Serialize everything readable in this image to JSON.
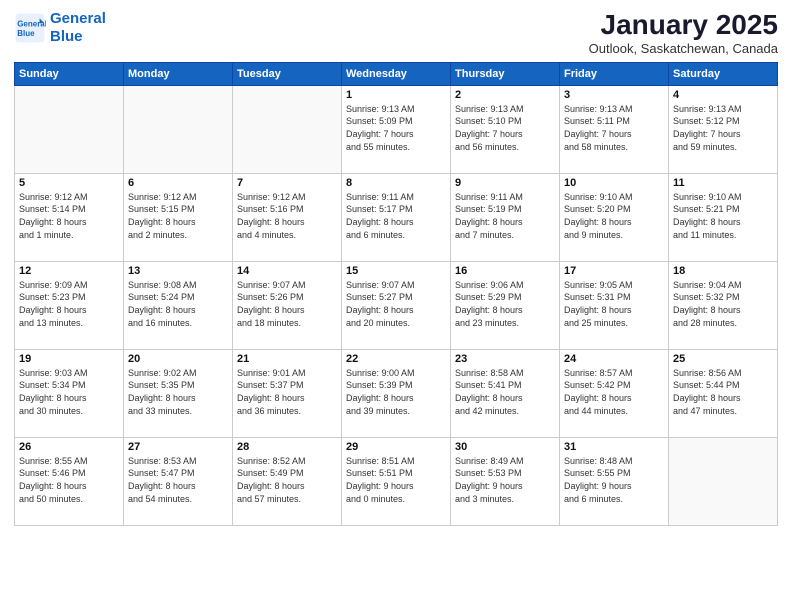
{
  "header": {
    "logo_line1": "General",
    "logo_line2": "Blue",
    "month": "January 2025",
    "location": "Outlook, Saskatchewan, Canada"
  },
  "weekdays": [
    "Sunday",
    "Monday",
    "Tuesday",
    "Wednesday",
    "Thursday",
    "Friday",
    "Saturday"
  ],
  "weeks": [
    [
      {
        "day": "",
        "info": ""
      },
      {
        "day": "",
        "info": ""
      },
      {
        "day": "",
        "info": ""
      },
      {
        "day": "1",
        "info": "Sunrise: 9:13 AM\nSunset: 5:09 PM\nDaylight: 7 hours\nand 55 minutes."
      },
      {
        "day": "2",
        "info": "Sunrise: 9:13 AM\nSunset: 5:10 PM\nDaylight: 7 hours\nand 56 minutes."
      },
      {
        "day": "3",
        "info": "Sunrise: 9:13 AM\nSunset: 5:11 PM\nDaylight: 7 hours\nand 58 minutes."
      },
      {
        "day": "4",
        "info": "Sunrise: 9:13 AM\nSunset: 5:12 PM\nDaylight: 7 hours\nand 59 minutes."
      }
    ],
    [
      {
        "day": "5",
        "info": "Sunrise: 9:12 AM\nSunset: 5:14 PM\nDaylight: 8 hours\nand 1 minute."
      },
      {
        "day": "6",
        "info": "Sunrise: 9:12 AM\nSunset: 5:15 PM\nDaylight: 8 hours\nand 2 minutes."
      },
      {
        "day": "7",
        "info": "Sunrise: 9:12 AM\nSunset: 5:16 PM\nDaylight: 8 hours\nand 4 minutes."
      },
      {
        "day": "8",
        "info": "Sunrise: 9:11 AM\nSunset: 5:17 PM\nDaylight: 8 hours\nand 6 minutes."
      },
      {
        "day": "9",
        "info": "Sunrise: 9:11 AM\nSunset: 5:19 PM\nDaylight: 8 hours\nand 7 minutes."
      },
      {
        "day": "10",
        "info": "Sunrise: 9:10 AM\nSunset: 5:20 PM\nDaylight: 8 hours\nand 9 minutes."
      },
      {
        "day": "11",
        "info": "Sunrise: 9:10 AM\nSunset: 5:21 PM\nDaylight: 8 hours\nand 11 minutes."
      }
    ],
    [
      {
        "day": "12",
        "info": "Sunrise: 9:09 AM\nSunset: 5:23 PM\nDaylight: 8 hours\nand 13 minutes."
      },
      {
        "day": "13",
        "info": "Sunrise: 9:08 AM\nSunset: 5:24 PM\nDaylight: 8 hours\nand 16 minutes."
      },
      {
        "day": "14",
        "info": "Sunrise: 9:07 AM\nSunset: 5:26 PM\nDaylight: 8 hours\nand 18 minutes."
      },
      {
        "day": "15",
        "info": "Sunrise: 9:07 AM\nSunset: 5:27 PM\nDaylight: 8 hours\nand 20 minutes."
      },
      {
        "day": "16",
        "info": "Sunrise: 9:06 AM\nSunset: 5:29 PM\nDaylight: 8 hours\nand 23 minutes."
      },
      {
        "day": "17",
        "info": "Sunrise: 9:05 AM\nSunset: 5:31 PM\nDaylight: 8 hours\nand 25 minutes."
      },
      {
        "day": "18",
        "info": "Sunrise: 9:04 AM\nSunset: 5:32 PM\nDaylight: 8 hours\nand 28 minutes."
      }
    ],
    [
      {
        "day": "19",
        "info": "Sunrise: 9:03 AM\nSunset: 5:34 PM\nDaylight: 8 hours\nand 30 minutes."
      },
      {
        "day": "20",
        "info": "Sunrise: 9:02 AM\nSunset: 5:35 PM\nDaylight: 8 hours\nand 33 minutes."
      },
      {
        "day": "21",
        "info": "Sunrise: 9:01 AM\nSunset: 5:37 PM\nDaylight: 8 hours\nand 36 minutes."
      },
      {
        "day": "22",
        "info": "Sunrise: 9:00 AM\nSunset: 5:39 PM\nDaylight: 8 hours\nand 39 minutes."
      },
      {
        "day": "23",
        "info": "Sunrise: 8:58 AM\nSunset: 5:41 PM\nDaylight: 8 hours\nand 42 minutes."
      },
      {
        "day": "24",
        "info": "Sunrise: 8:57 AM\nSunset: 5:42 PM\nDaylight: 8 hours\nand 44 minutes."
      },
      {
        "day": "25",
        "info": "Sunrise: 8:56 AM\nSunset: 5:44 PM\nDaylight: 8 hours\nand 47 minutes."
      }
    ],
    [
      {
        "day": "26",
        "info": "Sunrise: 8:55 AM\nSunset: 5:46 PM\nDaylight: 8 hours\nand 50 minutes."
      },
      {
        "day": "27",
        "info": "Sunrise: 8:53 AM\nSunset: 5:47 PM\nDaylight: 8 hours\nand 54 minutes."
      },
      {
        "day": "28",
        "info": "Sunrise: 8:52 AM\nSunset: 5:49 PM\nDaylight: 8 hours\nand 57 minutes."
      },
      {
        "day": "29",
        "info": "Sunrise: 8:51 AM\nSunset: 5:51 PM\nDaylight: 9 hours\nand 0 minutes."
      },
      {
        "day": "30",
        "info": "Sunrise: 8:49 AM\nSunset: 5:53 PM\nDaylight: 9 hours\nand 3 minutes."
      },
      {
        "day": "31",
        "info": "Sunrise: 8:48 AM\nSunset: 5:55 PM\nDaylight: 9 hours\nand 6 minutes."
      },
      {
        "day": "",
        "info": ""
      }
    ]
  ]
}
